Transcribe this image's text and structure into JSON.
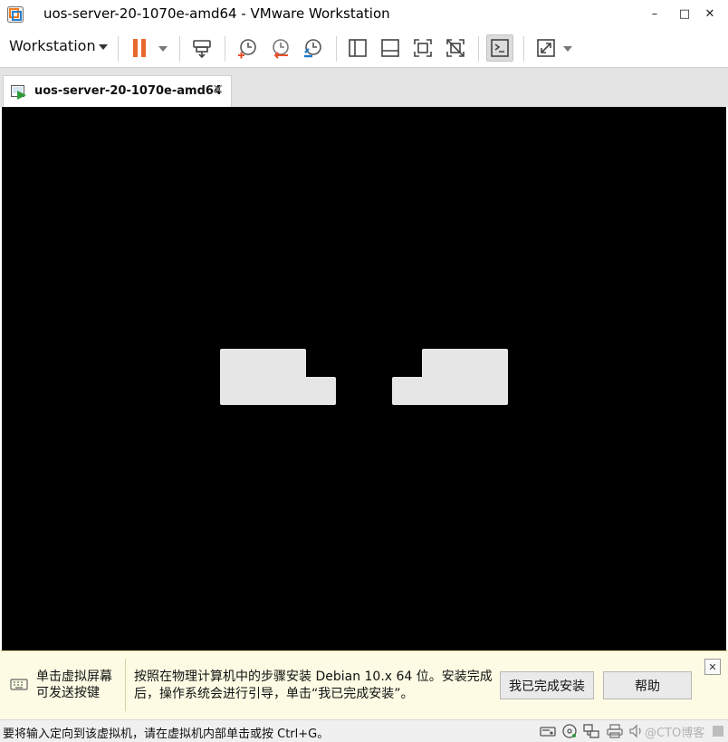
{
  "window": {
    "title": "uos-server-20-1070e-amd64 - VMware Workstation",
    "controls": {
      "minimize": "–",
      "maximize": "□",
      "close": "✕"
    }
  },
  "toolbar": {
    "workstation_menu": "Workstation",
    "buttons": [
      "pause-icon",
      "send-ctrl-alt-del-icon",
      "snapshot-icon",
      "revert-snapshot-icon",
      "snapshot-manager-icon",
      "library-view-icon",
      "thumbnail-view-icon",
      "full-screen-icon",
      "unity-icon",
      "console-view-icon",
      "stretch-icon"
    ]
  },
  "tab": {
    "label": "uos-server-20-1070e-amd64",
    "close": "✕"
  },
  "hint": {
    "left_text": "单击虚拟屏幕可发送按键",
    "main_text": "按照在物理计算机中的步骤安装 Debian 10.x 64 位。安装完成后，操作系统会进行引导，单击“我已完成安装”。",
    "done_button": "我已完成安装",
    "help_button": "帮助",
    "close": "✕"
  },
  "status": {
    "text": "要将输入定向到该虚拟机，请在虚拟机内部单击或按 Ctrl+G。",
    "watermark": "@CTO博客"
  },
  "colors": {
    "pause_orange": "#e9692c",
    "snapshot_red": "#e8502a",
    "snapshot_blue": "#1f78c8",
    "vm_screen": "#000000",
    "logo_gray": "#e6e6e6",
    "hint_bg": "#fdfbe3"
  }
}
